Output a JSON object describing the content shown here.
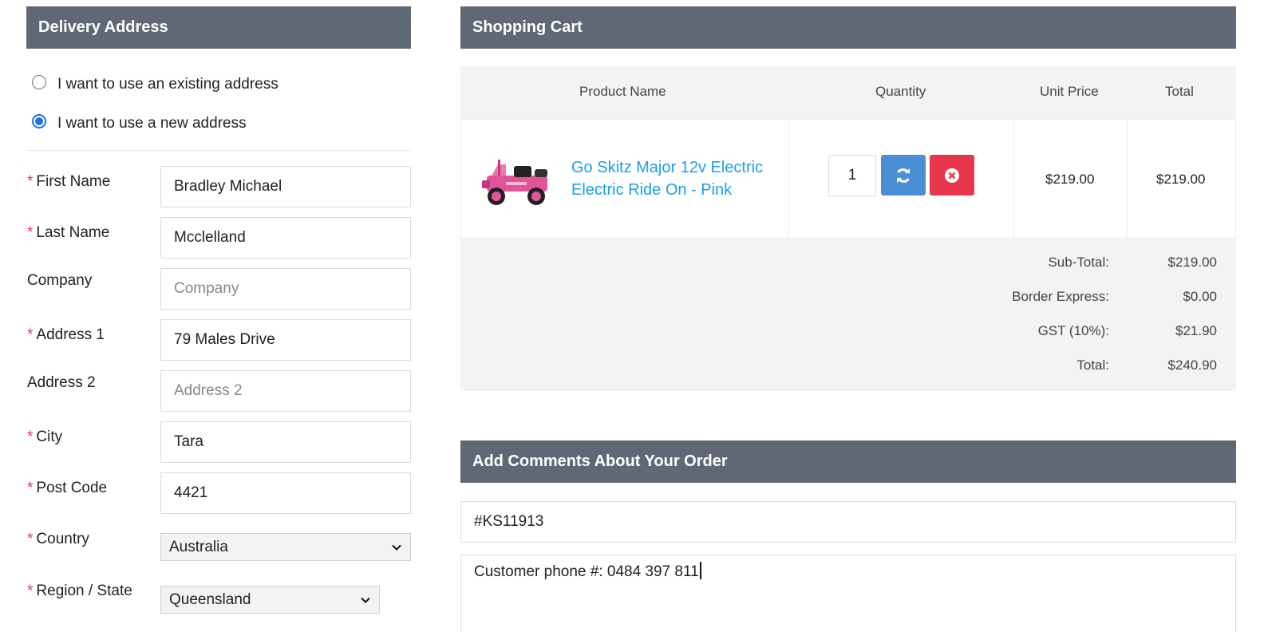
{
  "delivery": {
    "title": "Delivery Address",
    "radio_existing": "I want to use an existing address",
    "radio_new": "I want to use a new address",
    "selected": "new",
    "fields": {
      "first_name": {
        "label": "First Name",
        "required": "*",
        "value": "Bradley Michael"
      },
      "last_name": {
        "label": "Last Name",
        "required": "*",
        "value": "Mcclelland"
      },
      "company": {
        "label": "Company",
        "placeholder": "Company"
      },
      "address1": {
        "label": "Address 1",
        "required": "*",
        "value": "79 Males Drive"
      },
      "address2": {
        "label": "Address 2",
        "placeholder": "Address 2"
      },
      "city": {
        "label": "City",
        "required": "*",
        "value": "Tara"
      },
      "postcode": {
        "label": "Post Code",
        "required": "*",
        "value": "4421"
      },
      "country": {
        "label": "Country",
        "required": "*",
        "value": "Australia"
      },
      "region": {
        "label": "Region / State",
        "required": "*",
        "value": "Queensland"
      }
    }
  },
  "cart": {
    "title": "Shopping Cart",
    "columns": {
      "product": "Product Name",
      "quantity": "Quantity",
      "unit_price": "Unit Price",
      "total": "Total"
    },
    "item": {
      "name": "Go Skitz Major 12v Electric Electric Ride On - Pink",
      "quantity": "1",
      "unit_price": "$219.00",
      "total": "$219.00"
    },
    "totals": [
      {
        "label": "Sub-Total:",
        "value": "$219.00"
      },
      {
        "label": "Border Express:",
        "value": "$0.00"
      },
      {
        "label": "GST (10%):",
        "value": "$21.90"
      },
      {
        "label": "Total:",
        "value": "$240.90"
      }
    ]
  },
  "comments": {
    "title": "Add Comments About Your Order",
    "order_ref": "#KS11913",
    "text": "Customer phone #: 0484 397 811"
  },
  "colors": {
    "header_bg": "#606875",
    "required": "#e8374a",
    "link": "#1aa0e8",
    "refresh_button": "#4a8fd6",
    "remove_button": "#e8374a",
    "radio_checked": "#1a73e8"
  },
  "icons": {
    "refresh": "refresh-icon",
    "remove": "remove-circle-icon",
    "dropdown": "chevron-down-icon"
  }
}
